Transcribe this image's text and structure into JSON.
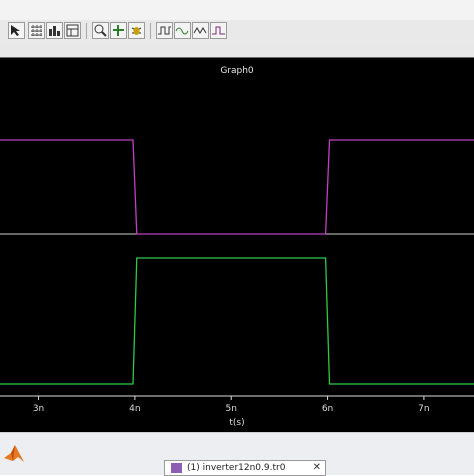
{
  "plot": {
    "title": "Graph0",
    "x_axis_label": "t(s)",
    "background": "#000000",
    "colors": {
      "trace_top": "#c040c0",
      "trace_bottom": "#2fc84a",
      "baseline": "#cfcfcf",
      "axis": "#dcdcdc"
    }
  },
  "chart_data": {
    "type": "line",
    "title": "Graph0",
    "xlabel": "t(s)",
    "ylabel": "",
    "x_tick_labels": [
      "3n",
      "4n",
      "5n",
      "6n",
      "7n"
    ],
    "x_ticks": [
      3,
      4,
      5,
      6,
      7
    ],
    "xlim": [
      2.6,
      7.52
    ],
    "series": [
      {
        "color": "#c040c0",
        "x": [
          2.6,
          3.98,
          4.02,
          5.98,
          6.02,
          7.52
        ],
        "values": [
          1,
          1,
          0,
          0,
          1,
          1
        ]
      },
      {
        "color": "#2fc84a",
        "x": [
          2.6,
          3.98,
          4.02,
          5.98,
          6.02,
          7.52
        ],
        "values": [
          0,
          0,
          1,
          1,
          0,
          0
        ]
      }
    ]
  },
  "toolbar": {
    "icons": [
      "select-arrow-icon",
      "grid-icon",
      "bar-chart-icon",
      "panel-icon",
      "zoom-fit-icon",
      "cursor-settings-icon",
      "bug-icon",
      "wave-measure-icon",
      "wave-compare-icon",
      "wave-add-icon",
      "wave-delete-icon"
    ]
  },
  "taskbar": {
    "document_tab": "(1) inverter12n0.9.tr0",
    "close_glyph": "✕",
    "app_icon": "matlab-icon"
  }
}
